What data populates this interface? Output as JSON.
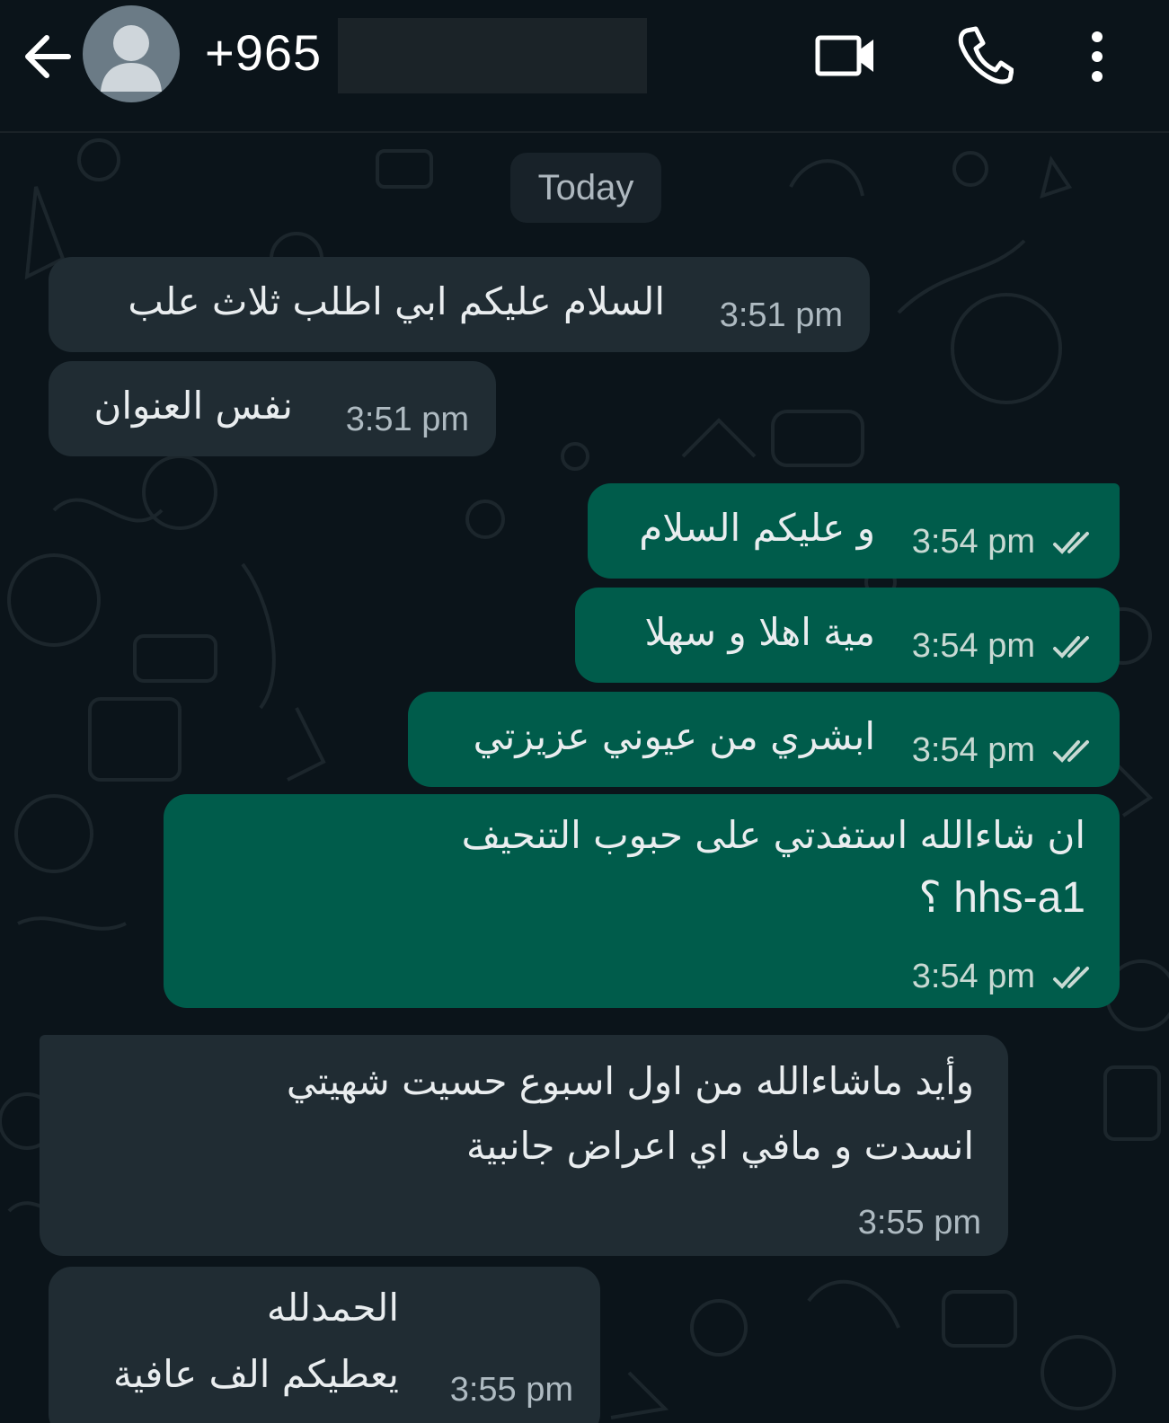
{
  "header": {
    "contact_number": "+965",
    "icons": {
      "back": "arrow-left-icon",
      "avatar": "default-avatar-icon",
      "video": "video-camera-icon",
      "call": "phone-icon",
      "menu": "more-vertical-icon"
    }
  },
  "chat": {
    "date_label": "Today",
    "messages": [
      {
        "direction": "incoming",
        "lines": [
          "السلام عليكم ابي اطلب ثلاث علب"
        ],
        "time": "3:51 pm"
      },
      {
        "direction": "incoming",
        "lines": [
          "نفس العنوان"
        ],
        "time": "3:51 pm"
      },
      {
        "direction": "outgoing",
        "lines": [
          "و عليكم السلام"
        ],
        "time": "3:54 pm",
        "status": "read-double-check"
      },
      {
        "direction": "outgoing",
        "lines": [
          "مية اهلا و سهلا"
        ],
        "time": "3:54 pm",
        "status": "read-double-check"
      },
      {
        "direction": "outgoing",
        "lines": [
          "ابشري من عيوني عزيزتي"
        ],
        "time": "3:54 pm",
        "status": "read-double-check"
      },
      {
        "direction": "outgoing",
        "lines": [
          "ان شاءالله استفدتي على حبوب التنحيف",
          "hhs-a1 ؟"
        ],
        "time": "3:54 pm",
        "status": "read-double-check"
      },
      {
        "direction": "incoming",
        "lines": [
          "وأيد ماشاءالله من اول اسبوع حسيت شهيتي",
          "انسدت و مافي اي اعراض جانبية"
        ],
        "time": "3:55 pm"
      },
      {
        "direction": "incoming",
        "lines": [
          "الحمدلله",
          "يعطيكم الف عافية"
        ],
        "time": "3:55 pm"
      }
    ]
  },
  "colors": {
    "background": "#0b141a",
    "incoming_bubble": "#202c33",
    "outgoing_bubble": "#005c4b",
    "text": "#e9edef",
    "meta_text": "#aebac1"
  }
}
